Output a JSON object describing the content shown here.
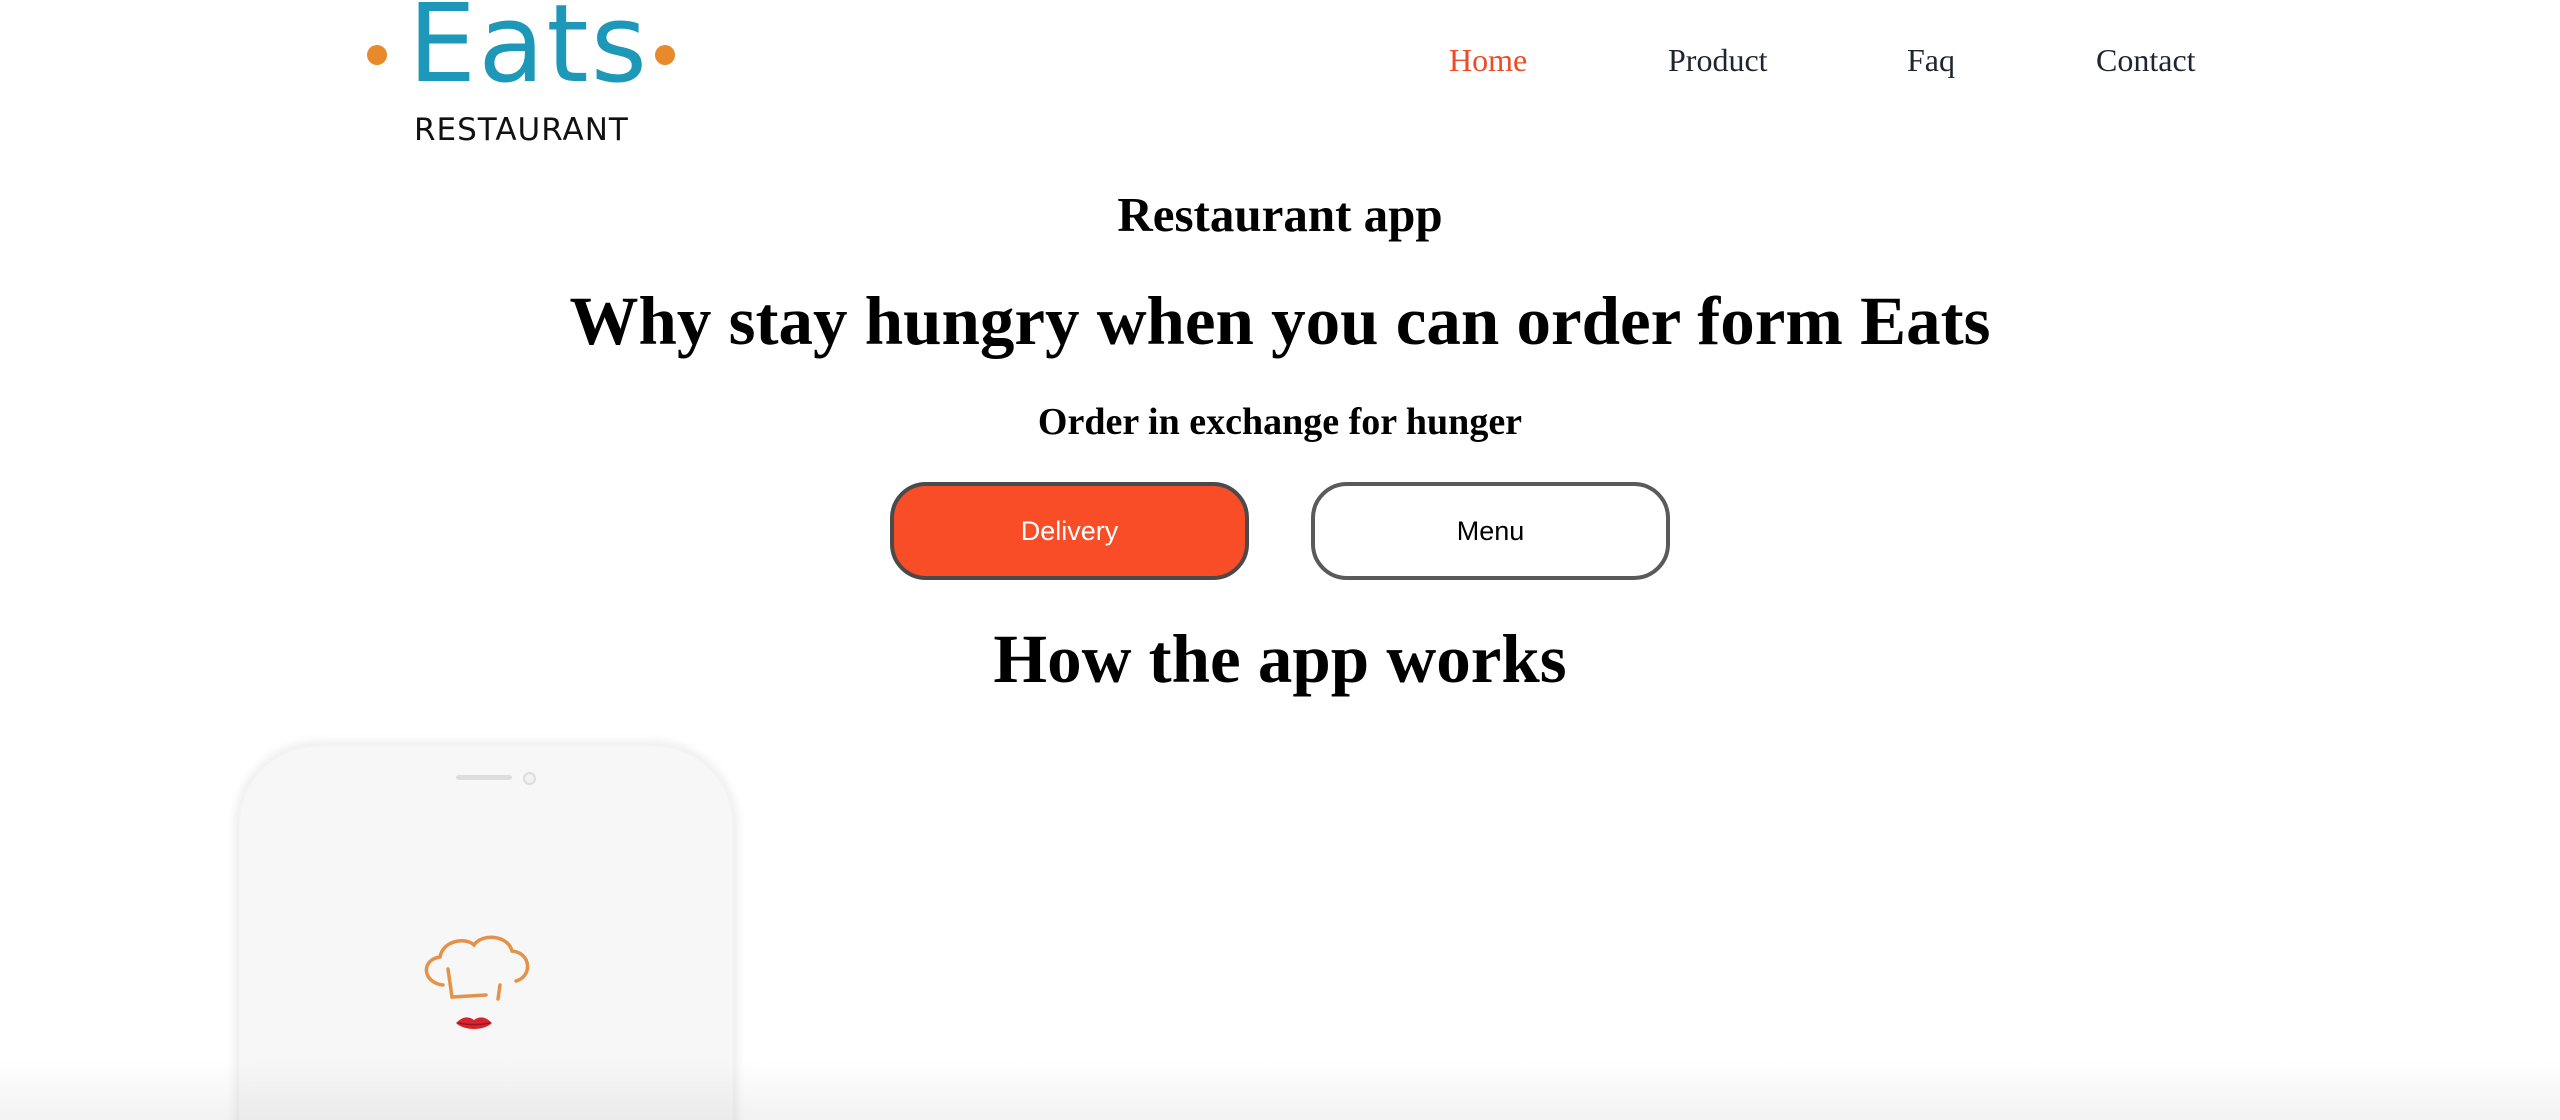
{
  "brand": {
    "name": "Eats",
    "subtitle": "RESTAURANT",
    "colors": {
      "primary": "#1e98b8",
      "dots": "#e8892b"
    }
  },
  "nav": {
    "items": [
      {
        "label": "Home",
        "active": true
      },
      {
        "label": "Product",
        "active": false
      },
      {
        "label": "Faq",
        "active": false
      },
      {
        "label": "Contact",
        "active": false
      }
    ],
    "active_color": "#ec4b25"
  },
  "hero": {
    "eyebrow": "Restaurant app",
    "headline": "Why stay hungry when you can order form Eats",
    "tagline": "Order in exchange for hunger",
    "primary_button": "Delivery",
    "secondary_button": "Menu",
    "primary_color": "#f84d27"
  },
  "how_it_works": {
    "title": "How the app works",
    "phone_icons": [
      "chef-hat-icon",
      "lips-icon"
    ]
  }
}
